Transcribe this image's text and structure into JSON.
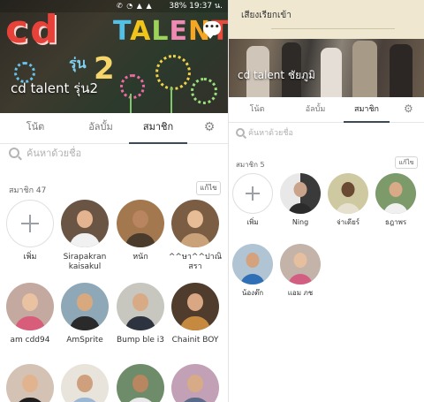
{
  "left": {
    "status": {
      "text": "38% 19:37 น.",
      "icons": "✆ ◔ ▲ ▲"
    },
    "cover": {
      "art_cd": "cd",
      "art_talent": "TALENT",
      "art_run": "รุ่น",
      "art_two": "2"
    },
    "group": {
      "name": "cd talent รุ่น2"
    },
    "tabs": [
      {
        "label": "โน้ต"
      },
      {
        "label": "อัลบั้ม"
      },
      {
        "label": "สมาชิก"
      }
    ],
    "search": {
      "placeholder": "ค้นหาด้วยชื่อ"
    },
    "members_count": "สมาชิก 47",
    "edit_label": "แก้ไข",
    "members": [
      {
        "name": "เพิ่ม"
      },
      {
        "name": "Sirapakran kaisakul"
      },
      {
        "name": "หนัก"
      },
      {
        "name": "^^ษา^^ปาณิสรา"
      },
      {
        "name": "am cdd94"
      },
      {
        "name": "AmSprite"
      },
      {
        "name": "Bump ble i3"
      },
      {
        "name": "Chainit BOY"
      }
    ]
  },
  "right": {
    "top_title": "เสียงเรียกเข้า",
    "group": {
      "name": "cd talent ชัยภูมิ"
    },
    "tabs": [
      {
        "label": "โน้ต"
      },
      {
        "label": "อัลบั้ม"
      },
      {
        "label": "สมาชิก"
      }
    ],
    "search": {
      "placeholder": "ค้นหาด้วยชื่อ"
    },
    "members_count": "สมาชิก 5",
    "edit_label": "แก้ไข",
    "members": [
      {
        "name": "เพิ่ม"
      },
      {
        "name": "Ning"
      },
      {
        "name": "จ่าเดียร์"
      },
      {
        "name": "ธฎาพร"
      },
      {
        "name": "น้องต๊ก"
      },
      {
        "name": "แอม ภช"
      }
    ]
  },
  "colors": {
    "tab_underline": "#3d4a5a",
    "top_banner": "#efe7cf",
    "chalk_red": "#e7423a"
  },
  "icons": {
    "search": "search-icon",
    "gear": "gear-icon",
    "add": "plus-icon",
    "chat": "chat-icon"
  }
}
